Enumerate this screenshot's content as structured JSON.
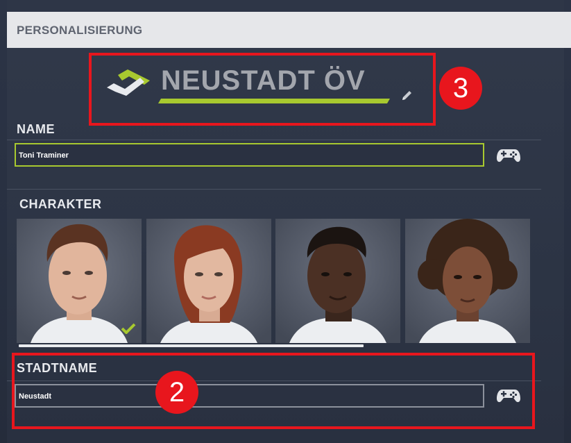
{
  "header": {
    "title": "PERSONALISIERUNG"
  },
  "company": {
    "name": "NEUSTADT ÖV",
    "accent_color": "#a8c92f"
  },
  "name_section": {
    "label": "NAME",
    "value": "Toni Traminer"
  },
  "character_section": {
    "label": "CHARAKTER",
    "characters": [
      {
        "id": "male-caucasian",
        "selected": true
      },
      {
        "id": "female-redhair",
        "selected": false
      },
      {
        "id": "male-dark",
        "selected": false
      },
      {
        "id": "female-curly",
        "selected": false
      }
    ]
  },
  "city_section": {
    "label": "STADTNAME",
    "value": "Neustadt"
  },
  "callouts": [
    {
      "number": "3"
    },
    {
      "number": "2"
    }
  ],
  "colors": {
    "callout_red": "#e8161d",
    "field_active_border": "#a8c92f",
    "field_border": "#8c919c"
  }
}
